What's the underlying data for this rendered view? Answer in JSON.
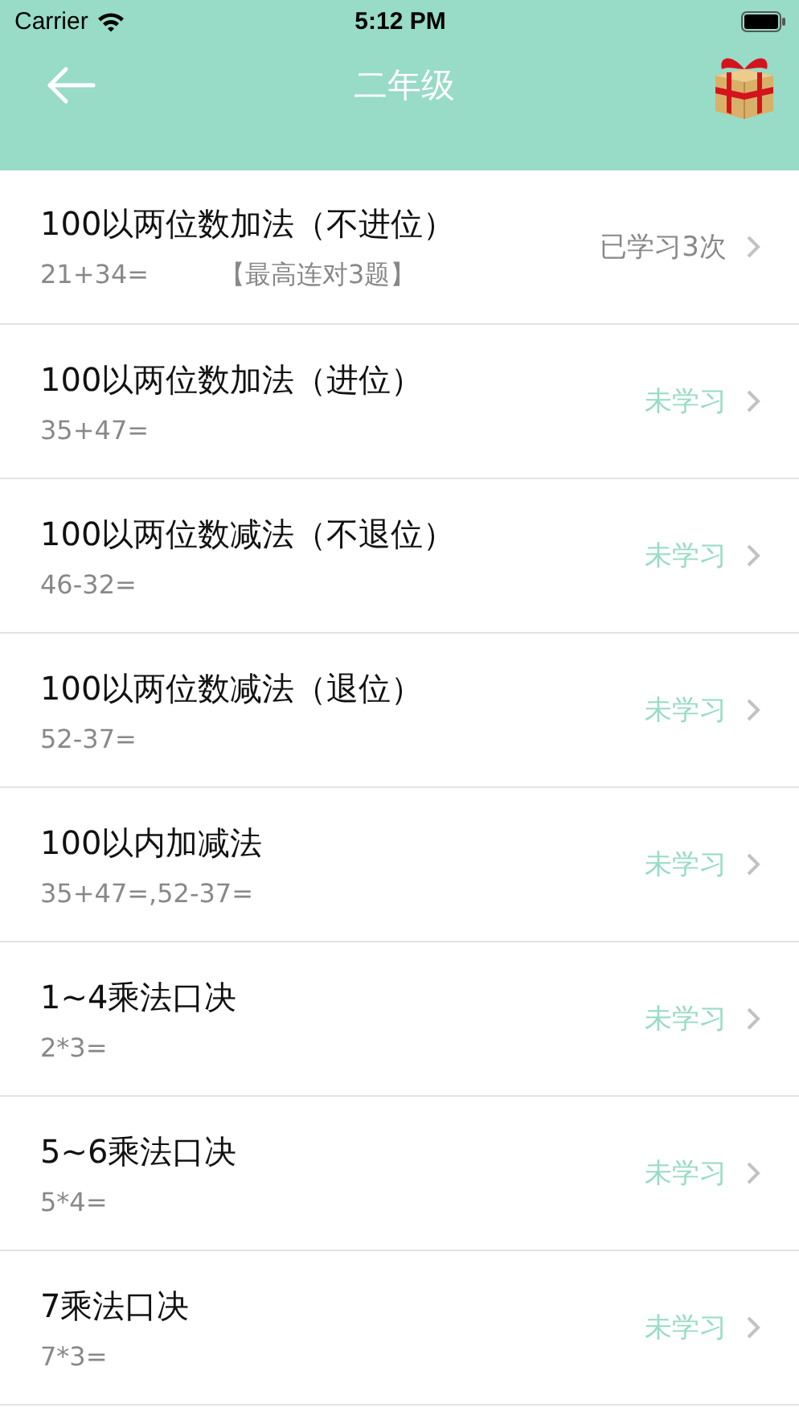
{
  "status_bar": {
    "carrier": "Carrier",
    "time": "5:12 PM"
  },
  "nav": {
    "title": "二年级"
  },
  "lessons": [
    {
      "title": "100以两位数加法（不进位）",
      "example": "21+34=",
      "best": "【最高连对3题】",
      "status": "已学习3次",
      "studied": true
    },
    {
      "title": "100以两位数加法（进位）",
      "example": "35+47=",
      "status": "未学习",
      "studied": false
    },
    {
      "title": "100以两位数减法（不退位）",
      "example": "46-32=",
      "status": "未学习",
      "studied": false
    },
    {
      "title": "100以两位数减法（退位）",
      "example": "52-37=",
      "status": "未学习",
      "studied": false
    },
    {
      "title": "100以内加减法",
      "example": "35+47=,52-37=",
      "status": "未学习",
      "studied": false
    },
    {
      "title": "1~4乘法口决",
      "example": "2*3=",
      "status": "未学习",
      "studied": false
    },
    {
      "title": "5~6乘法口决",
      "example": "5*4=",
      "status": "未学习",
      "studied": false
    },
    {
      "title": "7乘法口决",
      "example": "7*3=",
      "status": "未学习",
      "studied": false
    }
  ]
}
